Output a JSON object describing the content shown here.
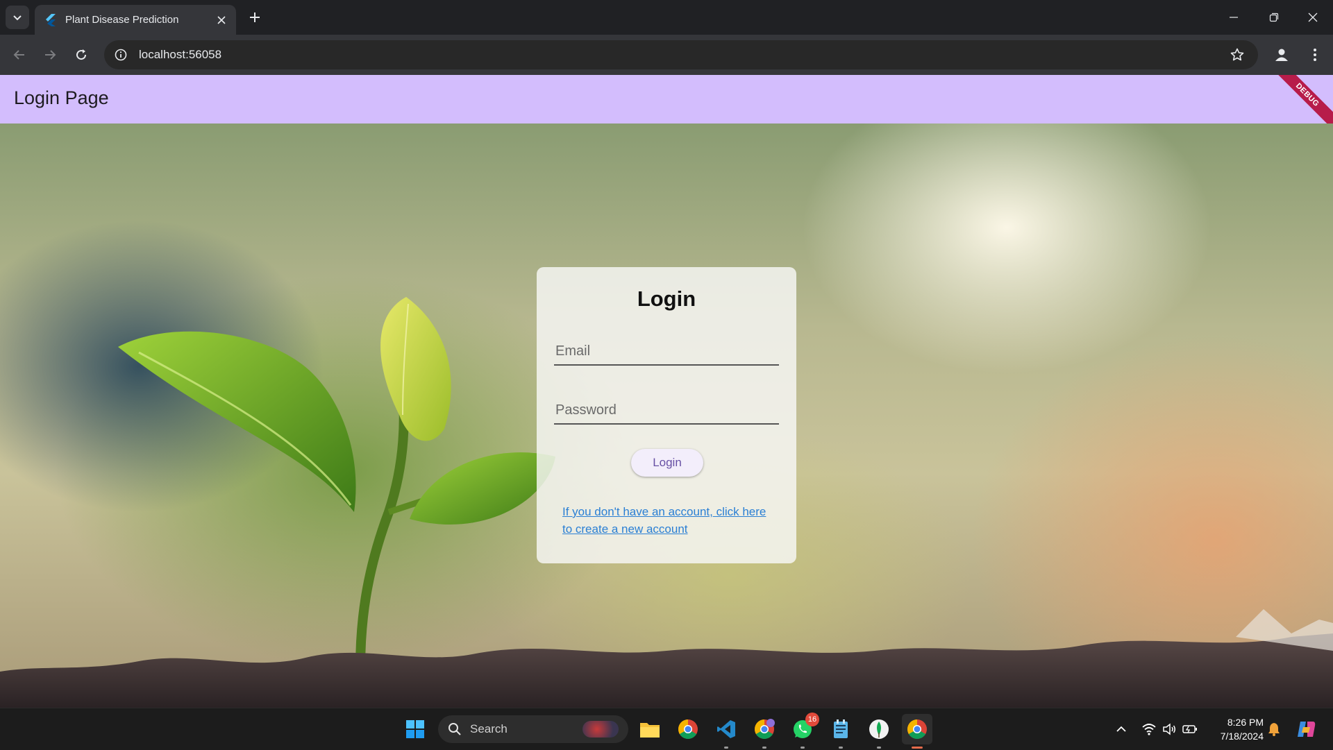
{
  "browser": {
    "tab_title": "Plant Disease Prediction",
    "url": "localhost:56058",
    "icons": [
      "tab-search-icon",
      "flutter-icon",
      "close-icon",
      "plus-icon",
      "minimize-icon",
      "restore-icon",
      "close-window-icon",
      "back-icon",
      "forward-icon",
      "reload-icon",
      "info-icon",
      "star-icon",
      "profile-icon",
      "more-icon"
    ]
  },
  "app": {
    "appbar_title": "Login Page",
    "debug_banner": "DEBUG",
    "colors": {
      "appbar": "#d3bdfd",
      "accent": "#6750a4",
      "link": "#2a7fd4"
    }
  },
  "login": {
    "title": "Login",
    "email_placeholder": "Email",
    "password_placeholder": "Password",
    "button_label": "Login",
    "signup_link": "If you don't have an account, click here to create a new account"
  },
  "taskbar": {
    "search_label": "Search",
    "notification_badge": "16",
    "time": "8:26 PM",
    "date": "7/18/2024"
  }
}
